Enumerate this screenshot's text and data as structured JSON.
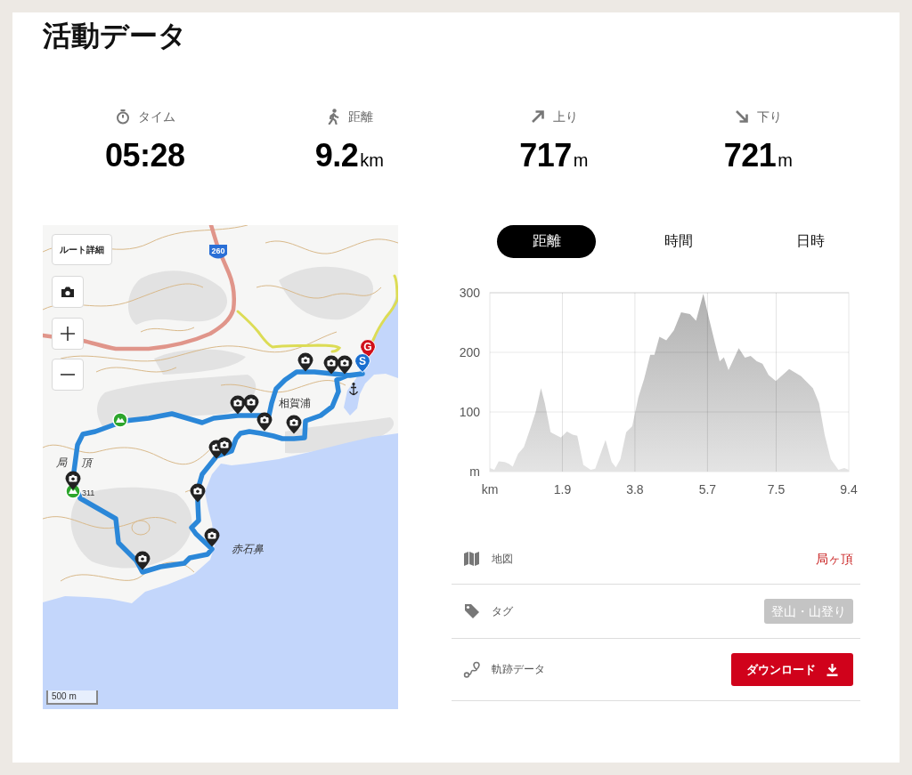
{
  "title": "活動データ",
  "stats": [
    {
      "kind": "time",
      "label": "タイム",
      "value": "05:28"
    },
    {
      "kind": "distance",
      "label": "距離",
      "value": "9.2",
      "unit": "km"
    },
    {
      "kind": "ascent",
      "label": "上り",
      "value": "717",
      "unit": "m"
    },
    {
      "kind": "descent",
      "label": "下り",
      "value": "721",
      "unit": "m"
    }
  ],
  "map": {
    "route_detail_button": "ルート詳細",
    "road_number": "260",
    "labels": [
      {
        "kind": "place",
        "text": "相賀浦"
      },
      {
        "kind": "cape",
        "text": "赤石鼻"
      },
      {
        "kind": "peak",
        "text": "局 頂"
      },
      {
        "kind": "elevation",
        "text": "311"
      }
    ],
    "start_marker": "S",
    "goal_marker": "G",
    "scale": "500 m"
  },
  "elevation": {
    "tabs": [
      {
        "label": "距離",
        "selected": true
      },
      {
        "label": "時間",
        "selected": false
      },
      {
        "label": "日時",
        "selected": false
      }
    ],
    "chart_data": {
      "type": "area",
      "x": [
        0,
        0.12,
        0.23,
        0.39,
        0.5,
        0.6,
        0.74,
        0.89,
        1.09,
        1.2,
        1.34,
        1.44,
        1.59,
        1.86,
        2.02,
        2.17,
        2.29,
        2.45,
        2.64,
        2.76,
        3.03,
        3.19,
        3.3,
        3.42,
        3.57,
        3.73,
        3.89,
        4.04,
        4.2,
        4.31,
        4.44,
        4.62,
        4.82,
        5.01,
        5.24,
        5.4,
        5.59,
        5.75,
        5.9,
        6.02,
        6.13,
        6.25,
        6.52,
        6.68,
        6.83,
        6.99,
        7.14,
        7.3,
        7.49,
        7.84,
        8.15,
        8.46,
        8.62,
        8.77,
        8.93,
        9.13,
        9.28,
        9.4
      ],
      "series": [
        {
          "color": "#b0b0b0",
          "values": [
            6,
            3,
            17,
            16,
            13,
            8,
            30,
            41,
            78,
            100,
            140,
            115,
            66,
            57,
            67,
            62,
            60,
            11,
            3,
            5,
            53,
            16,
            7,
            21,
            66,
            76,
            125,
            155,
            196,
            196,
            226,
            220,
            237,
            267,
            264,
            253,
            298,
            254,
            215,
            185,
            192,
            170,
            207,
            191,
            194,
            185,
            181,
            162,
            152,
            172,
            160,
            140,
            115,
            61,
            21,
            3,
            6,
            3
          ]
        }
      ],
      "xlim": [
        0,
        9.4
      ],
      "ylim": [
        0,
        300
      ],
      "xticks": [
        {
          "value": 0,
          "label": "km"
        },
        1.9,
        3.8,
        5.7,
        7.5,
        9.4
      ],
      "yticks": [
        {
          "value": 0,
          "label": "m"
        },
        100,
        200,
        300
      ],
      "grid": true
    }
  },
  "details": [
    {
      "kind": "map",
      "label": "地図",
      "value": "局ヶ頂"
    },
    {
      "kind": "tag",
      "label": "タグ",
      "tag": "登山・山登り"
    },
    {
      "kind": "track",
      "label": "軌跡データ",
      "button": "ダウンロード"
    }
  ]
}
